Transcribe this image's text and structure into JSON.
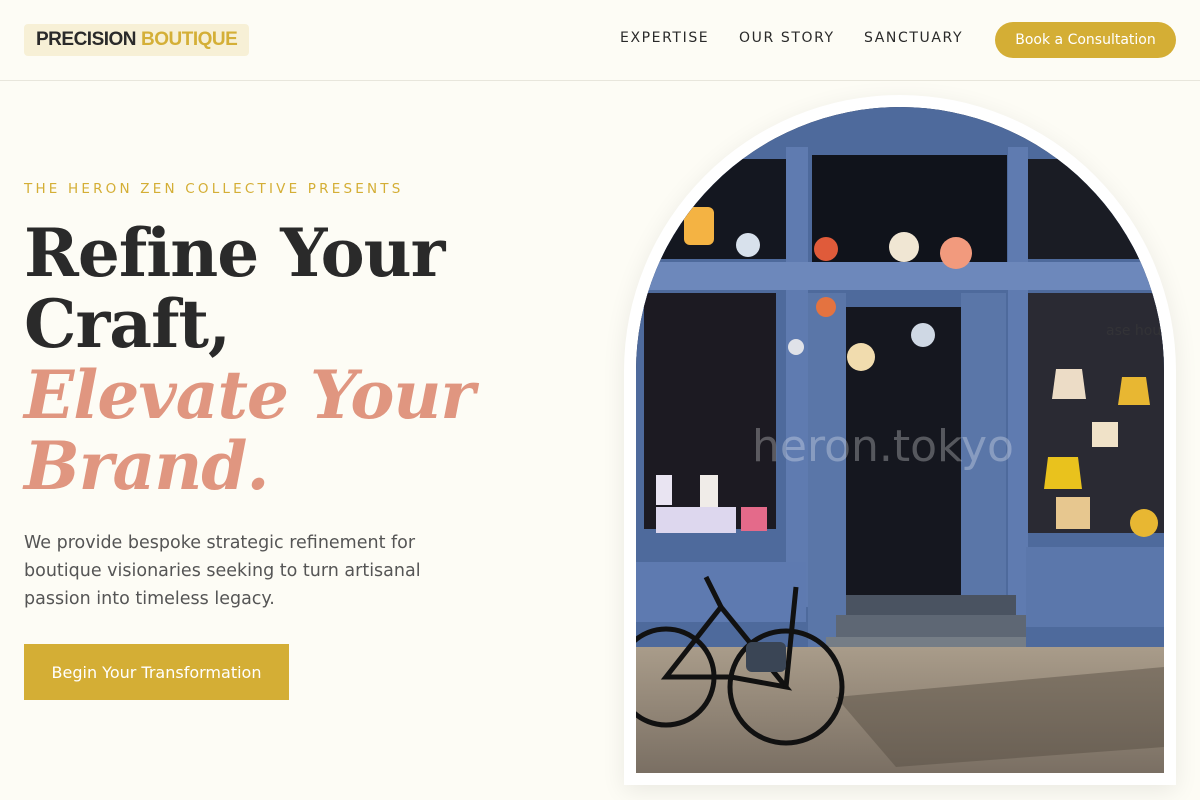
{
  "header": {
    "logo_part1": "PRECISION",
    "logo_part2": "BOUTIQUE",
    "nav": [
      "EXPERTISE",
      "OUR STORY",
      "SANCTUARY"
    ],
    "cta": "Book a Consultation"
  },
  "hero": {
    "eyebrow": "THE HERON ZEN COLLECTIVE PRESENTS",
    "headline_line1": "Refine Your",
    "headline_line2": "Craft,",
    "headline_accent1": "Elevate Your",
    "headline_accent2": "Brand.",
    "paragraph": "We provide bespoke strategic refinement for boutique visionaries seeking to turn artisanal passion into timeless legacy.",
    "cta": "Begin Your Transformation"
  },
  "image": {
    "watermark": "heron.tokyo",
    "sign_text": "ase hous"
  },
  "colors": {
    "background": "#fdfcf5",
    "gold": "#d4ae35",
    "accent": "#e09680",
    "text": "#2a2a2a"
  }
}
